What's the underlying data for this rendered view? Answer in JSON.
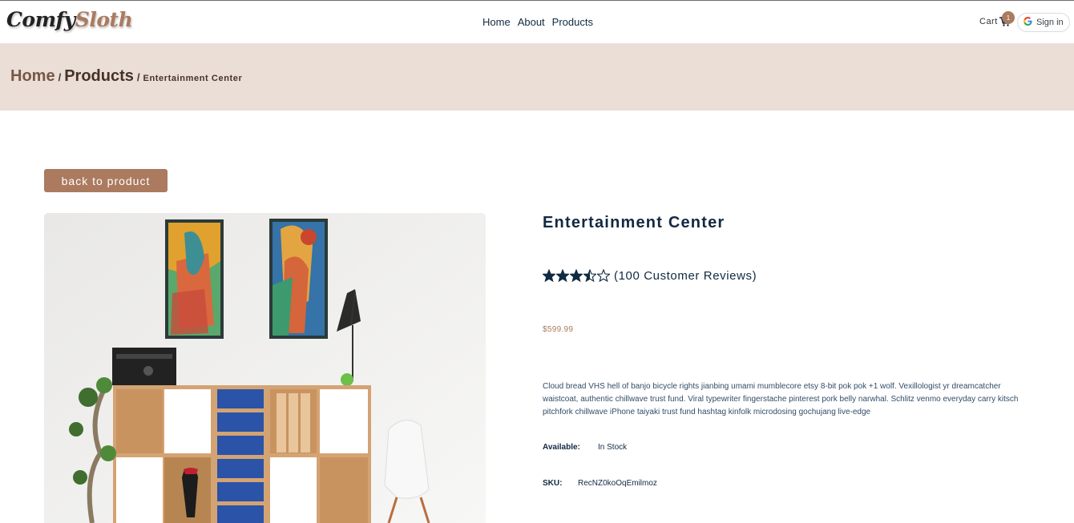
{
  "navbar": {
    "logo_part1": "Comfy",
    "logo_part2": "Sloth",
    "links": [
      "Home",
      "About",
      "Products"
    ],
    "cart_label": "Cart",
    "cart_count": "1",
    "signin_label": "Sign in"
  },
  "hero": {
    "crumb_home": "Home",
    "crumb_products": "Products",
    "separator": "/",
    "crumb_current": "Entertainment Center"
  },
  "back_button": "back to product",
  "product": {
    "title": "Entertainment Center",
    "rating": 3.5,
    "rating_max": 5,
    "reviews_text": "(100 Customer Reviews)",
    "price": "$599.99",
    "description": "Cloud bread VHS hell of banjo bicycle rights jianbing umami mumblecore etsy 8-bit pok pok +1 wolf. Vexillologist yr dreamcatcher waistcoat, authentic chillwave trust fund. Viral typewriter fingerstache pinterest pork belly narwhal. Schlitz venmo everyday carry kitsch pitchfork chillwave iPhone taiyaki trust fund hashtag kinfolk microdosing gochujang live-edge",
    "available_label": "Available:",
    "available_value": "In Stock",
    "sku_label": "SKU:",
    "sku_value": "RecNZ0koOqEmilmoz"
  },
  "colors": {
    "brand": "#ab7a5f",
    "hero_bg": "#eaded7",
    "text_dark": "#102a42"
  },
  "icons": [
    "cart-icon",
    "google-icon",
    "star-icon"
  ]
}
